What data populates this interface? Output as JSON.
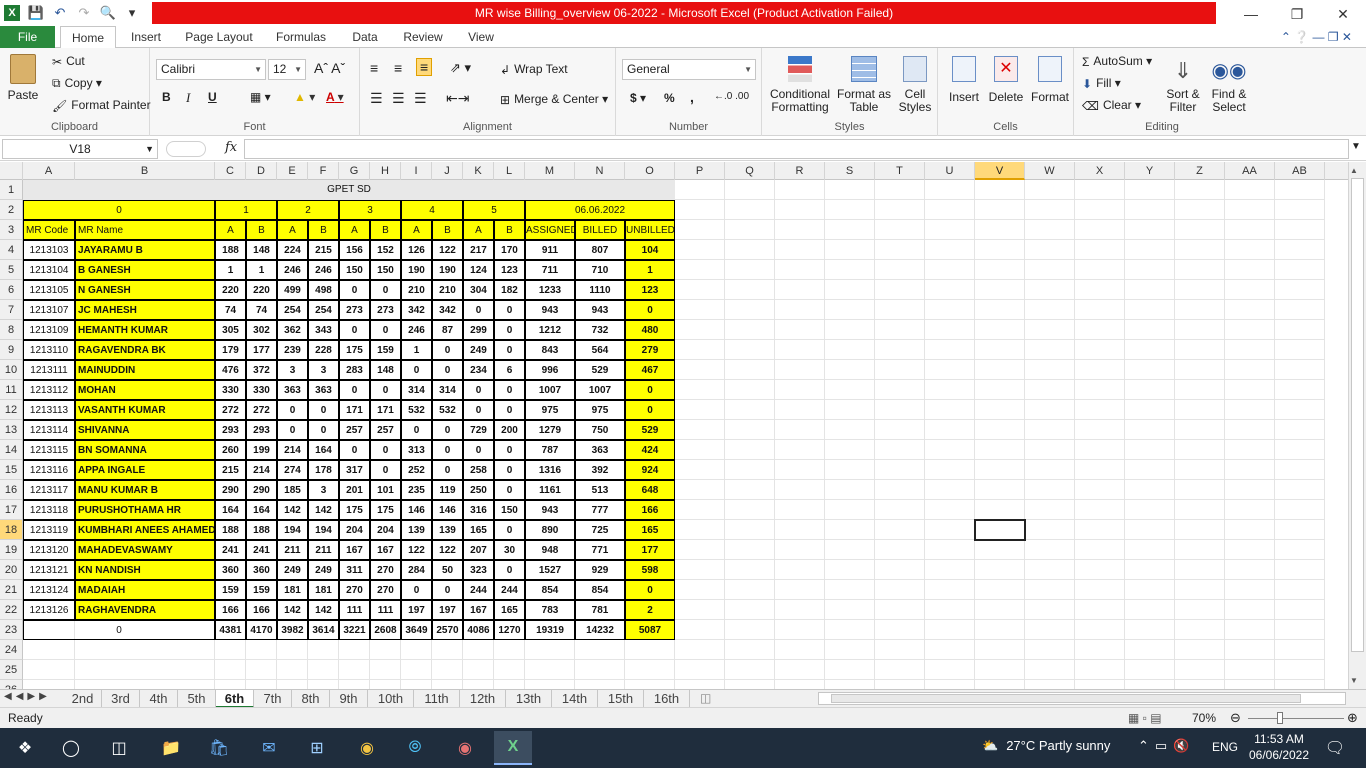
{
  "window": {
    "title": "MR wise Billing_overview 06-2022  -  Microsoft Excel (Product Activation Failed)"
  },
  "ribbon": {
    "tabs": [
      "File",
      "Home",
      "Insert",
      "Page Layout",
      "Formulas",
      "Data",
      "Review",
      "View"
    ],
    "clipboard": {
      "paste": "Paste",
      "cut": "Cut",
      "copy": "Copy",
      "format_painter": "Format Painter",
      "label": "Clipboard"
    },
    "font": {
      "name": "Calibri",
      "size": "12",
      "label": "Font",
      "bold": "B",
      "italic": "I",
      "underline": "U"
    },
    "alignment": {
      "wrap": "Wrap Text",
      "merge": "Merge & Center",
      "label": "Alignment"
    },
    "number": {
      "format": "General",
      "label": "Number",
      "currency": "$",
      "percent": "%",
      "comma": ","
    },
    "styles": {
      "conditional": "Conditional Formatting",
      "format_table": "Format as Table",
      "cell_styles": "Cell Styles",
      "label": "Styles"
    },
    "cells": {
      "insert": "Insert",
      "delete": "Delete",
      "format": "Format",
      "label": "Cells"
    },
    "editing": {
      "autosum": "AutoSum",
      "fill": "Fill",
      "clear": "Clear",
      "sort": "Sort & Filter",
      "find": "Find & Select",
      "label": "Editing"
    }
  },
  "formula_bar": {
    "name_box": "V18",
    "fx": "fx",
    "content": ""
  },
  "columns": [
    "A",
    "B",
    "C",
    "D",
    "E",
    "F",
    "G",
    "H",
    "I",
    "J",
    "K",
    "L",
    "M",
    "N",
    "O",
    "P",
    "Q",
    "R",
    "S",
    "T",
    "U",
    "V",
    "W",
    "X",
    "Y",
    "Z",
    "AA",
    "AB"
  ],
  "sheet": {
    "title": "GPET SD",
    "group_zero": "0",
    "groups": [
      "1",
      "2",
      "3",
      "4",
      "5"
    ],
    "date": "06.06.2022",
    "headers": [
      "MR Code",
      "MR Name",
      "A",
      "B",
      "A",
      "B",
      "A",
      "B",
      "A",
      "B",
      "A",
      "B",
      "ASSIGNED",
      "BILLED",
      "UNBILLED"
    ],
    "rows": [
      [
        "1213103",
        "JAYARAMU B",
        "188",
        "148",
        "224",
        "215",
        "156",
        "152",
        "126",
        "122",
        "217",
        "170",
        "911",
        "807",
        "104"
      ],
      [
        "1213104",
        "B GANESH",
        "1",
        "1",
        "246",
        "246",
        "150",
        "150",
        "190",
        "190",
        "124",
        "123",
        "711",
        "710",
        "1"
      ],
      [
        "1213105",
        "N GANESH",
        "220",
        "220",
        "499",
        "498",
        "0",
        "0",
        "210",
        "210",
        "304",
        "182",
        "1233",
        "1110",
        "123"
      ],
      [
        "1213107",
        "JC MAHESH",
        "74",
        "74",
        "254",
        "254",
        "273",
        "273",
        "342",
        "342",
        "0",
        "0",
        "943",
        "943",
        "0"
      ],
      [
        "1213109",
        "HEMANTH KUMAR",
        "305",
        "302",
        "362",
        "343",
        "0",
        "0",
        "246",
        "87",
        "299",
        "0",
        "1212",
        "732",
        "480"
      ],
      [
        "1213110",
        "RAGAVENDRA BK",
        "179",
        "177",
        "239",
        "228",
        "175",
        "159",
        "1",
        "0",
        "249",
        "0",
        "843",
        "564",
        "279"
      ],
      [
        "1213111",
        "MAINUDDIN",
        "476",
        "372",
        "3",
        "3",
        "283",
        "148",
        "0",
        "0",
        "234",
        "6",
        "996",
        "529",
        "467"
      ],
      [
        "1213112",
        "MOHAN",
        "330",
        "330",
        "363",
        "363",
        "0",
        "0",
        "314",
        "314",
        "0",
        "0",
        "1007",
        "1007",
        "0"
      ],
      [
        "1213113",
        "VASANTH KUMAR",
        "272",
        "272",
        "0",
        "0",
        "171",
        "171",
        "532",
        "532",
        "0",
        "0",
        "975",
        "975",
        "0"
      ],
      [
        "1213114",
        "SHIVANNA",
        "293",
        "293",
        "0",
        "0",
        "257",
        "257",
        "0",
        "0",
        "729",
        "200",
        "1279",
        "750",
        "529"
      ],
      [
        "1213115",
        "BN SOMANNA",
        "260",
        "199",
        "214",
        "164",
        "0",
        "0",
        "313",
        "0",
        "0",
        "0",
        "787",
        "363",
        "424"
      ],
      [
        "1213116",
        "APPA INGALE",
        "215",
        "214",
        "274",
        "178",
        "317",
        "0",
        "252",
        "0",
        "258",
        "0",
        "1316",
        "392",
        "924"
      ],
      [
        "1213117",
        "MANU KUMAR B",
        "290",
        "290",
        "185",
        "3",
        "201",
        "101",
        "235",
        "119",
        "250",
        "0",
        "1161",
        "513",
        "648"
      ],
      [
        "1213118",
        "PURUSHOTHAMA HR",
        "164",
        "164",
        "142",
        "142",
        "175",
        "175",
        "146",
        "146",
        "316",
        "150",
        "943",
        "777",
        "166"
      ],
      [
        "1213119",
        "KUMBHARI ANEES AHAMED",
        "188",
        "188",
        "194",
        "194",
        "204",
        "204",
        "139",
        "139",
        "165",
        "0",
        "890",
        "725",
        "165"
      ],
      [
        "1213120",
        "MAHADEVASWAMY",
        "241",
        "241",
        "211",
        "211",
        "167",
        "167",
        "122",
        "122",
        "207",
        "30",
        "948",
        "771",
        "177"
      ],
      [
        "1213121",
        "KN NANDISH",
        "360",
        "360",
        "249",
        "249",
        "311",
        "270",
        "284",
        "50",
        "323",
        "0",
        "1527",
        "929",
        "598"
      ],
      [
        "1213124",
        "MADAIAH",
        "159",
        "159",
        "181",
        "181",
        "270",
        "270",
        "0",
        "0",
        "244",
        "244",
        "854",
        "854",
        "0"
      ],
      [
        "1213126",
        "RAGHAVENDRA",
        "166",
        "166",
        "142",
        "142",
        "111",
        "111",
        "197",
        "197",
        "167",
        "165",
        "783",
        "781",
        "2"
      ]
    ],
    "total_label": "0",
    "totals": [
      "4381",
      "4170",
      "3982",
      "3614",
      "3221",
      "2608",
      "3649",
      "2570",
      "4086",
      "1270",
      "19319",
      "14232",
      "5087"
    ]
  },
  "sheet_tabs": [
    "2nd",
    "3rd",
    "4th",
    "5th",
    "6th",
    "7th",
    "8th",
    "9th",
    "10th",
    "11th",
    "12th",
    "13th",
    "14th",
    "15th",
    "16th"
  ],
  "active_sheet": "6th",
  "status": {
    "ready": "Ready",
    "zoom": "70%"
  },
  "taskbar": {
    "weather": "27°C  Partly sunny",
    "lang": "ENG",
    "time": "11:53 AM",
    "date": "06/06/2022"
  }
}
